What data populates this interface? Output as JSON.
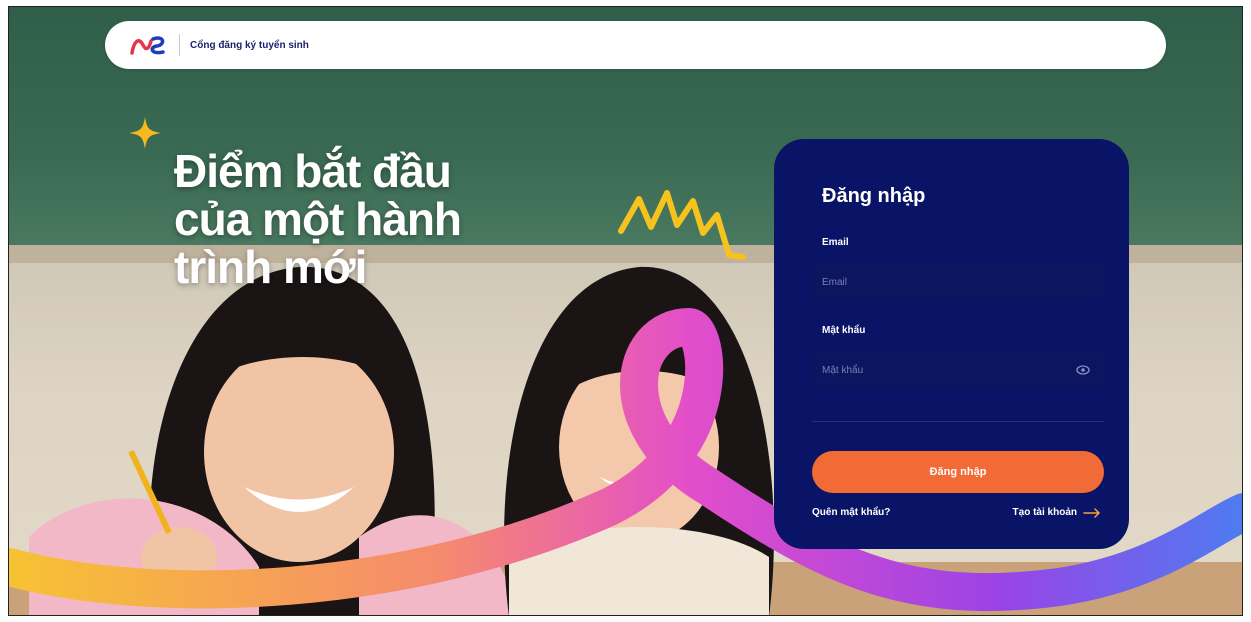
{
  "header": {
    "logo_text": "NS",
    "title": "Cổng đăng ký tuyển sinh"
  },
  "hero": {
    "line1": "Điểm bắt đầu",
    "line2": "của một hành",
    "line3": "trình mới"
  },
  "login": {
    "title": "Đăng nhập",
    "email_label": "Email",
    "email_placeholder": "Email",
    "password_label": "Mật khẩu",
    "password_placeholder": "Mật khẩu",
    "submit_label": "Đăng nhập",
    "forgot_label": "Quên mật khẩu?",
    "create_label": "Tạo tài khoản"
  },
  "colors": {
    "card_bg": "#0a1466",
    "button_bg": "#f26a35",
    "brand": "#1a1f6e"
  },
  "icons": [
    "logo-icon",
    "sparkle-icon",
    "zigzag-icon",
    "eye-icon",
    "arrow-right-icon"
  ]
}
